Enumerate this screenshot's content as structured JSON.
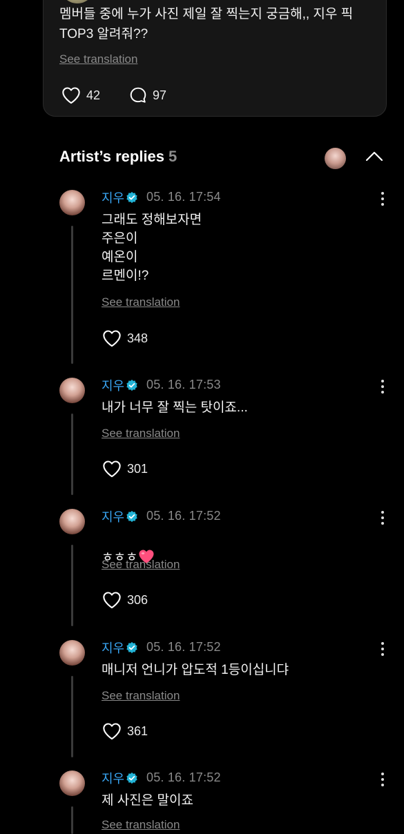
{
  "post": {
    "text": "멤버들 중에 누가 사진 제일 잘 찍는지 궁금해,, 지우 픽\nTOP3 알려줘??",
    "see_translation": "See translation",
    "likes": "42",
    "comments": "97"
  },
  "replies_header": {
    "title": "Artist’s replies",
    "count": "5"
  },
  "replies": [
    {
      "name": "지우",
      "time": "05. 16. 17:54",
      "text": "그래도 정해보자면\n주은이\n예온이\n르멘이!?",
      "see_translation": "See translation",
      "likes": "348"
    },
    {
      "name": "지우",
      "time": "05. 16. 17:53",
      "text": "내가 너무 잘 찍는 탓이죠...",
      "see_translation": "See translation",
      "likes": "301"
    },
    {
      "name": "지우",
      "time": "05. 16. 17:52",
      "text": "ㅎㅎㅎ",
      "see_translation": "See translation",
      "likes": "306"
    },
    {
      "name": "지우",
      "time": "05. 16. 17:52",
      "text": "매니저 언니가 압도적 1등이십니댜",
      "see_translation": "See translation",
      "likes": "361"
    },
    {
      "name": "지우",
      "time": "05. 16. 17:52",
      "text": "제 사진은 말이죠",
      "see_translation": "See translation",
      "likes": ""
    }
  ],
  "colors": {
    "background": "#000000",
    "artist_name": "#39a6f4",
    "verified_badge": "#22b3d6",
    "muted": "#8a8a8a",
    "heart_emoji": "#ff4f7d"
  },
  "icons": {
    "like": "heart-outline-icon",
    "comment": "speech-bubble-icon",
    "verified": "verified-badge-icon",
    "more": "more-vertical-icon",
    "collapse": "chevron-up-icon"
  }
}
